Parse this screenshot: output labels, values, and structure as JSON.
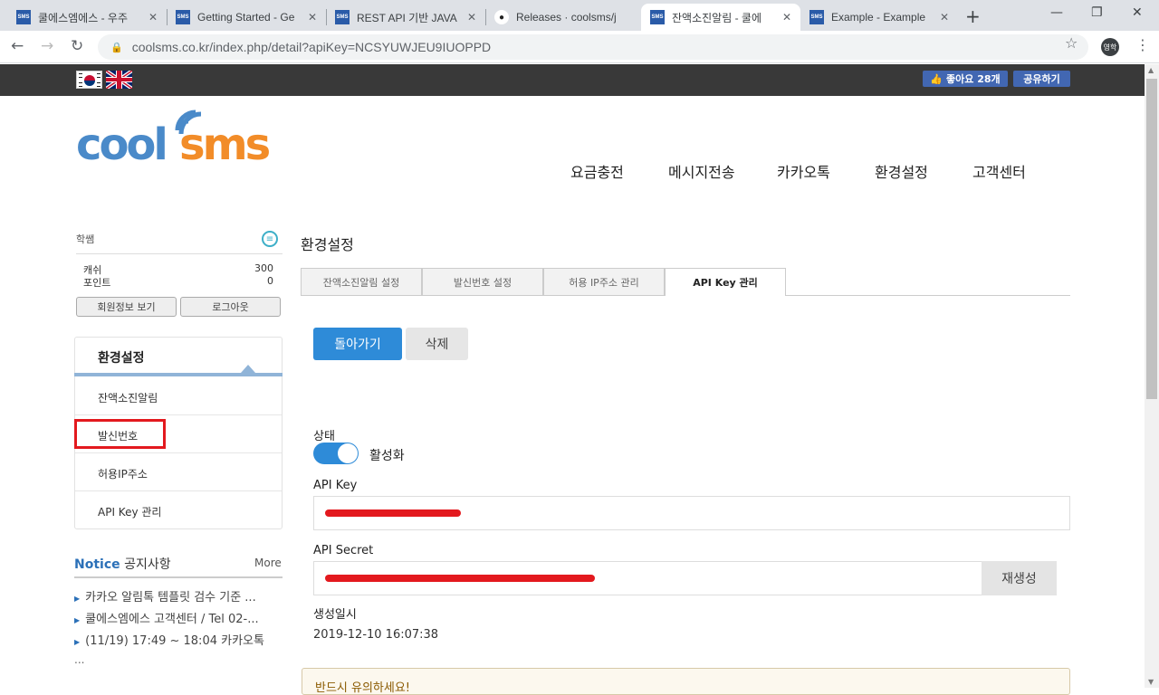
{
  "browser": {
    "tabs": [
      {
        "title": "쿨에스엠에스 - 우주",
        "favicon": "SMS"
      },
      {
        "title": "Getting Started - Ge",
        "favicon": "SMS"
      },
      {
        "title": "REST API 기반 JAVA",
        "favicon": "SMS"
      },
      {
        "title": "Releases · coolsms/j",
        "favicon": "github"
      },
      {
        "title": "잔액소진알림 - 쿨에",
        "favicon": "SMS"
      },
      {
        "title": "Example - Example",
        "favicon": "SMS"
      }
    ],
    "active_tab": 4,
    "url": "coolsms.co.kr/index.php/detail?apiKey=NCSYUWJEU9IUOPPD",
    "profile": "영학"
  },
  "topbar": {
    "fb_like": "좋아요 28개",
    "fb_share": "공유하기"
  },
  "logo": {
    "part1": "cool",
    "part2": "sms"
  },
  "nav": [
    "요금충전",
    "메시지전송",
    "카카오톡",
    "환경설정",
    "고객센터"
  ],
  "sidebar": {
    "user": "학쌤",
    "cash_label": "캐쉬",
    "cash_value": "300",
    "point_label": "포인트",
    "point_value": "0",
    "btn_profile": "회원정보 보기",
    "btn_logout": "로그아웃",
    "menu_title": "환경설정",
    "menu_items": [
      "잔액소진알림",
      "발신번호",
      "허용IP주소",
      "API Key 관리"
    ]
  },
  "notice": {
    "title_en": "Notice",
    "title_ko": "공지사항",
    "more": "More",
    "items": [
      "카카오 알림톡 템플릿 검수 기준 ...",
      "쿨에스엠에스 고객센터 / Tel 02-...",
      "(11/19) 17:49 ~ 18:04 카카오톡"
    ],
    "ellipsis": "..."
  },
  "content": {
    "title": "환경설정",
    "tabs": [
      "잔액소진알림 설정",
      "발신번호 설정",
      "허용 IP주소 관리",
      "API Key 관리"
    ],
    "active_tab": 3,
    "btn_back": "돌아가기",
    "btn_delete": "삭제",
    "status_label": "상태",
    "status_value": "활성화",
    "status_on": true,
    "api_key_label": "API Key",
    "api_secret_label": "API Secret",
    "btn_regen": "재생성",
    "created_label": "생성일시",
    "created_value": "2019-12-10 16:07:38",
    "warning": "반드시 유의하세요!"
  },
  "colors": {
    "accent": "#2e8bd8",
    "highlight": "#e3191e",
    "topbar": "#393939"
  }
}
